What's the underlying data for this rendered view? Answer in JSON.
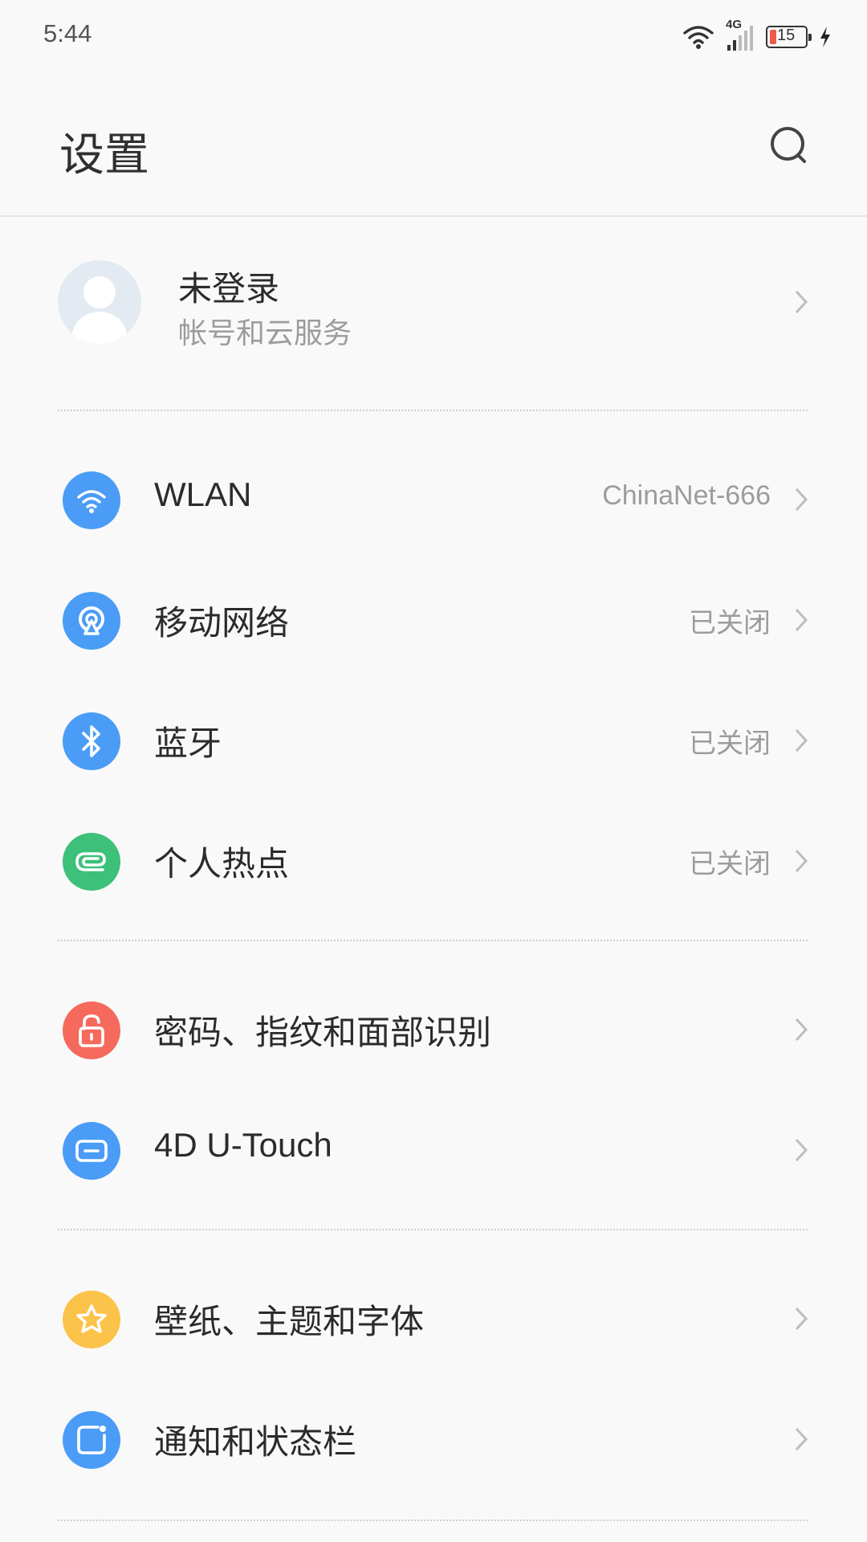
{
  "status_bar": {
    "time": "5:44",
    "network_type": "4G",
    "battery_level": "15",
    "icons": [
      "wifi-icon",
      "cellular-signal-icon",
      "battery-icon",
      "charging-icon"
    ]
  },
  "header": {
    "title": "设置",
    "search_icon": "search-icon"
  },
  "account": {
    "name": "未登录",
    "subtitle": "帐号和云服务"
  },
  "groups": [
    {
      "items": [
        {
          "label": "WLAN",
          "value": "ChinaNet-666",
          "icon": "wifi-icon",
          "color": "#4a9cf6"
        },
        {
          "label": "移动网络",
          "value": "已关闭",
          "icon": "mobile-network-icon",
          "color": "#4a9cf6"
        },
        {
          "label": "蓝牙",
          "value": "已关闭",
          "icon": "bluetooth-icon",
          "color": "#4a9cf6"
        },
        {
          "label": "个人热点",
          "value": "已关闭",
          "icon": "hotspot-icon",
          "color": "#3cc07a"
        }
      ]
    },
    {
      "items": [
        {
          "label": "密码、指纹和面部识别",
          "value": "",
          "icon": "lock-icon",
          "color": "#f56a5c"
        },
        {
          "label": "4D U-Touch",
          "value": "",
          "icon": "touch-icon",
          "color": "#4a9cf6"
        }
      ]
    },
    {
      "items": [
        {
          "label": "壁纸、主题和字体",
          "value": "",
          "icon": "star-icon",
          "color": "#fcc34a"
        },
        {
          "label": "通知和状态栏",
          "value": "",
          "icon": "notification-icon",
          "color": "#4a9cf6"
        }
      ]
    }
  ]
}
